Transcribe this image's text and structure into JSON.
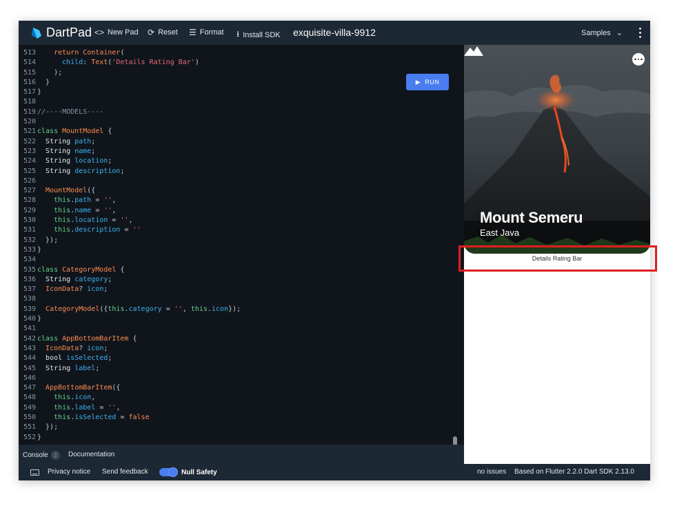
{
  "header": {
    "brand": "DartPad",
    "new_pad": "New Pad",
    "reset": "Reset",
    "format": "Format",
    "install_sdk": "Install SDK",
    "pad_name": "exquisite-villa-9912",
    "samples": "Samples"
  },
  "editor": {
    "run_label": "RUN",
    "lines": [
      {
        "n": "513",
        "tokens": [
          [
            "p",
            "    "
          ],
          [
            "k",
            "return "
          ],
          [
            "cl",
            "Container"
          ],
          [
            "p",
            "("
          ]
        ]
      },
      {
        "n": "514",
        "tokens": [
          [
            "p",
            "      "
          ],
          [
            "v",
            "child"
          ],
          [
            "p",
            ": "
          ],
          [
            "cl",
            "Text"
          ],
          [
            "p",
            "("
          ],
          [
            "s",
            "'Details Rating Bar'"
          ],
          [
            "p",
            ")"
          ]
        ]
      },
      {
        "n": "515",
        "tokens": [
          [
            "p",
            "    );"
          ]
        ]
      },
      {
        "n": "516",
        "tokens": [
          [
            "p",
            "  }"
          ]
        ]
      },
      {
        "n": "517",
        "tokens": [
          [
            "p",
            "}"
          ]
        ]
      },
      {
        "n": "518",
        "tokens": []
      },
      {
        "n": "519",
        "tokens": [
          [
            "c",
            "//----MODELS----"
          ]
        ]
      },
      {
        "n": "520",
        "tokens": []
      },
      {
        "n": "521",
        "tokens": [
          [
            "th",
            "class "
          ],
          [
            "cl",
            "MountModel"
          ],
          [
            "p",
            " {"
          ]
        ]
      },
      {
        "n": "522",
        "tokens": [
          [
            "p",
            "  "
          ],
          [
            "ty",
            "String "
          ],
          [
            "v",
            "path"
          ],
          [
            "p",
            ";"
          ]
        ]
      },
      {
        "n": "523",
        "tokens": [
          [
            "p",
            "  "
          ],
          [
            "ty",
            "String "
          ],
          [
            "v",
            "name"
          ],
          [
            "p",
            ";"
          ]
        ]
      },
      {
        "n": "524",
        "tokens": [
          [
            "p",
            "  "
          ],
          [
            "ty",
            "String "
          ],
          [
            "v",
            "location"
          ],
          [
            "p",
            ";"
          ]
        ]
      },
      {
        "n": "525",
        "tokens": [
          [
            "p",
            "  "
          ],
          [
            "ty",
            "String "
          ],
          [
            "v",
            "description"
          ],
          [
            "p",
            ";"
          ]
        ]
      },
      {
        "n": "526",
        "tokens": []
      },
      {
        "n": "527",
        "tokens": [
          [
            "p",
            "  "
          ],
          [
            "cl",
            "MountModel"
          ],
          [
            "p",
            "({"
          ]
        ]
      },
      {
        "n": "528",
        "tokens": [
          [
            "p",
            "    "
          ],
          [
            "th",
            "this"
          ],
          [
            "p",
            "."
          ],
          [
            "v",
            "path"
          ],
          [
            "p",
            " = "
          ],
          [
            "s",
            "''"
          ],
          [
            "p",
            ","
          ]
        ]
      },
      {
        "n": "529",
        "tokens": [
          [
            "p",
            "    "
          ],
          [
            "th",
            "this"
          ],
          [
            "p",
            "."
          ],
          [
            "v",
            "name"
          ],
          [
            "p",
            " = "
          ],
          [
            "s",
            "''"
          ],
          [
            "p",
            ","
          ]
        ]
      },
      {
        "n": "530",
        "tokens": [
          [
            "p",
            "    "
          ],
          [
            "th",
            "this"
          ],
          [
            "p",
            "."
          ],
          [
            "v",
            "location"
          ],
          [
            "p",
            " = "
          ],
          [
            "s",
            "''"
          ],
          [
            "p",
            ","
          ]
        ]
      },
      {
        "n": "531",
        "tokens": [
          [
            "p",
            "    "
          ],
          [
            "th",
            "this"
          ],
          [
            "p",
            "."
          ],
          [
            "v",
            "description"
          ],
          [
            "p",
            " = "
          ],
          [
            "s",
            "''"
          ]
        ]
      },
      {
        "n": "532",
        "tokens": [
          [
            "p",
            "  });"
          ]
        ]
      },
      {
        "n": "533",
        "tokens": [
          [
            "p",
            "}"
          ]
        ]
      },
      {
        "n": "534",
        "tokens": []
      },
      {
        "n": "535",
        "tokens": [
          [
            "th",
            "class "
          ],
          [
            "cl",
            "CategoryModel"
          ],
          [
            "p",
            " {"
          ]
        ]
      },
      {
        "n": "536",
        "tokens": [
          [
            "p",
            "  "
          ],
          [
            "ty",
            "String "
          ],
          [
            "v",
            "category"
          ],
          [
            "p",
            ";"
          ]
        ]
      },
      {
        "n": "537",
        "tokens": [
          [
            "p",
            "  "
          ],
          [
            "cl",
            "IconData"
          ],
          [
            "p",
            "? "
          ],
          [
            "v",
            "icon"
          ],
          [
            "p",
            ";"
          ]
        ]
      },
      {
        "n": "538",
        "tokens": []
      },
      {
        "n": "539",
        "tokens": [
          [
            "p",
            "  "
          ],
          [
            "cl",
            "CategoryModel"
          ],
          [
            "p",
            "({"
          ],
          [
            "th",
            "this"
          ],
          [
            "p",
            "."
          ],
          [
            "v",
            "category"
          ],
          [
            "p",
            " = "
          ],
          [
            "s",
            "''"
          ],
          [
            "p",
            ", "
          ],
          [
            "th",
            "this"
          ],
          [
            "p",
            "."
          ],
          [
            "v",
            "icon"
          ],
          [
            "p",
            "});"
          ]
        ]
      },
      {
        "n": "540",
        "tokens": [
          [
            "p",
            "}"
          ]
        ]
      },
      {
        "n": "541",
        "tokens": []
      },
      {
        "n": "542",
        "tokens": [
          [
            "th",
            "class "
          ],
          [
            "cl",
            "AppBottomBarItem"
          ],
          [
            "p",
            " {"
          ]
        ]
      },
      {
        "n": "543",
        "tokens": [
          [
            "p",
            "  "
          ],
          [
            "cl",
            "IconData"
          ],
          [
            "p",
            "? "
          ],
          [
            "v",
            "icon"
          ],
          [
            "p",
            ";"
          ]
        ]
      },
      {
        "n": "544",
        "tokens": [
          [
            "p",
            "  "
          ],
          [
            "ty",
            "bool "
          ],
          [
            "v",
            "isSelected"
          ],
          [
            "p",
            ";"
          ]
        ]
      },
      {
        "n": "545",
        "tokens": [
          [
            "p",
            "  "
          ],
          [
            "ty",
            "String "
          ],
          [
            "v",
            "label"
          ],
          [
            "p",
            ";"
          ]
        ]
      },
      {
        "n": "546",
        "tokens": []
      },
      {
        "n": "547",
        "tokens": [
          [
            "p",
            "  "
          ],
          [
            "cl",
            "AppBottomBarItem"
          ],
          [
            "p",
            "({"
          ]
        ]
      },
      {
        "n": "548",
        "tokens": [
          [
            "p",
            "    "
          ],
          [
            "th",
            "this"
          ],
          [
            "p",
            "."
          ],
          [
            "v",
            "icon"
          ],
          [
            "p",
            ","
          ]
        ]
      },
      {
        "n": "549",
        "tokens": [
          [
            "p",
            "    "
          ],
          [
            "th",
            "this"
          ],
          [
            "p",
            "."
          ],
          [
            "v",
            "label"
          ],
          [
            "p",
            " = "
          ],
          [
            "s",
            "''"
          ],
          [
            "p",
            ","
          ]
        ]
      },
      {
        "n": "550",
        "tokens": [
          [
            "p",
            "    "
          ],
          [
            "th",
            "this"
          ],
          [
            "p",
            "."
          ],
          [
            "v",
            "isSelected"
          ],
          [
            "p",
            " = "
          ],
          [
            "k",
            "false"
          ]
        ]
      },
      {
        "n": "551",
        "tokens": [
          [
            "p",
            "  });"
          ]
        ]
      },
      {
        "n": "552",
        "tokens": [
          [
            "p",
            "}"
          ]
        ]
      }
    ]
  },
  "console_bar": {
    "console": "Console",
    "console_count": "2",
    "documentation": "Documentation"
  },
  "preview": {
    "card_title": "Mount Semeru",
    "card_subtitle": "East Java",
    "rating_label": "Details Rating Bar"
  },
  "status_bar": {
    "privacy": "Privacy notice",
    "feedback": "Send feedback",
    "null_safety": "Null Safety",
    "issues": "no issues",
    "version": "Based on Flutter 2.2.0 Dart SDK 2.13.0"
  },
  "colors": {
    "header_bg": "#1c2834",
    "editor_bg": "#10151c",
    "accent": "#4a7df0",
    "highlight": "#e01e1e"
  }
}
